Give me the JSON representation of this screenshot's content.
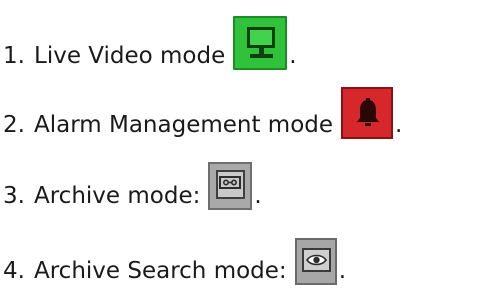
{
  "items": [
    {
      "number": "1.",
      "text": "Live Video mode",
      "suffix": ".",
      "icon": "monitor-icon",
      "icon_color": "#2fc23a"
    },
    {
      "number": "2.",
      "text": "Alarm Management mode",
      "suffix": ".",
      "icon": "bell-icon",
      "icon_color": "#d6282a"
    },
    {
      "number": "3.",
      "text": "Archive mode:",
      "suffix": ".",
      "icon": "cassette-icon",
      "icon_color": "#a9a9a9"
    },
    {
      "number": "4.",
      "text": "Archive Search mode:",
      "suffix": ".",
      "icon": "eye-icon",
      "icon_color": "#a7a7a7"
    }
  ]
}
